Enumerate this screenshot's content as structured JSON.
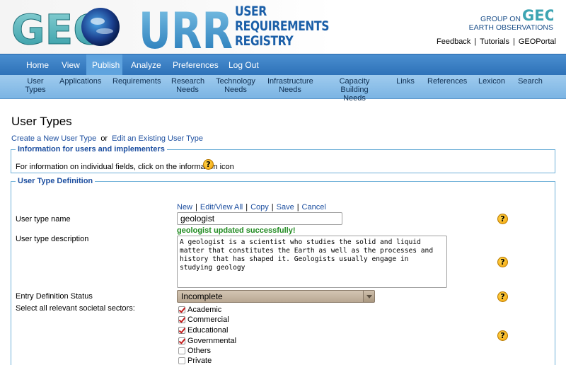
{
  "header": {
    "geo_logo_text": "GEO",
    "urr_logo_text": "URR",
    "urr_title_lines": [
      "USER",
      "REQUIREMENTS",
      "REGISTRY"
    ],
    "org_name_lines": [
      "GROUP ON",
      "EARTH OBSERVATIONS"
    ],
    "org_logo_text": "GEO",
    "top_links": [
      "Feedback",
      "Tutorials",
      "GEOPortal"
    ],
    "top_link_separator": "|"
  },
  "main_nav": {
    "items": [
      "Home",
      "View",
      "Publish",
      "Analyze",
      "Preferences",
      "Log Out"
    ],
    "active": "Publish"
  },
  "sub_nav": {
    "items": [
      [
        "User",
        "Types"
      ],
      [
        "Applications"
      ],
      [
        "Requirements"
      ],
      [
        "Research",
        "Needs"
      ],
      [
        "Technology",
        "Needs"
      ],
      [
        "Infrastructure",
        "Needs"
      ],
      [
        "Capacity Building",
        "Needs"
      ],
      [
        "Links"
      ],
      [
        "References"
      ],
      [
        "Lexicon"
      ],
      [
        "Search"
      ]
    ]
  },
  "page": {
    "title": "User Types",
    "create_link": "Create a New User Type",
    "or_text": "or",
    "edit_link": "Edit an Existing User Type"
  },
  "info_section": {
    "legend": "Information for users and implementers",
    "text": "For information on individual fields, click on the information icon"
  },
  "definition_section": {
    "legend": "User Type Definition",
    "actions": [
      "New",
      "Edit/View All",
      "Copy",
      "Save",
      "Cancel"
    ],
    "action_separator": "|",
    "name_label": "User type name",
    "name_value": "geologist",
    "success_message": "geologist updated successfully!",
    "description_label": "User type description",
    "description_value": "A geologist is a scientist who studies the solid and liquid matter that constitutes the Earth as well as the processes and history that has shaped it. Geologists usually engage in studying geology",
    "status_label": "Entry Definition Status",
    "status_value": "Incomplete",
    "sectors_label": "Select all relevant societal sectors:",
    "sectors": [
      {
        "label": "Academic",
        "checked": true
      },
      {
        "label": "Commercial",
        "checked": true
      },
      {
        "label": "Educational",
        "checked": true
      },
      {
        "label": "Governmental",
        "checked": true
      },
      {
        "label": "Others",
        "checked": false
      },
      {
        "label": "Private",
        "checked": false
      }
    ]
  },
  "help_icon_glyph": "?",
  "colors": {
    "nav_blue": "#2e72b8",
    "subnav_blue": "#7bb4e3",
    "link_blue": "#1d4fa0",
    "success_green": "#1f8a1f",
    "border_blue": "#6fb0d8"
  }
}
